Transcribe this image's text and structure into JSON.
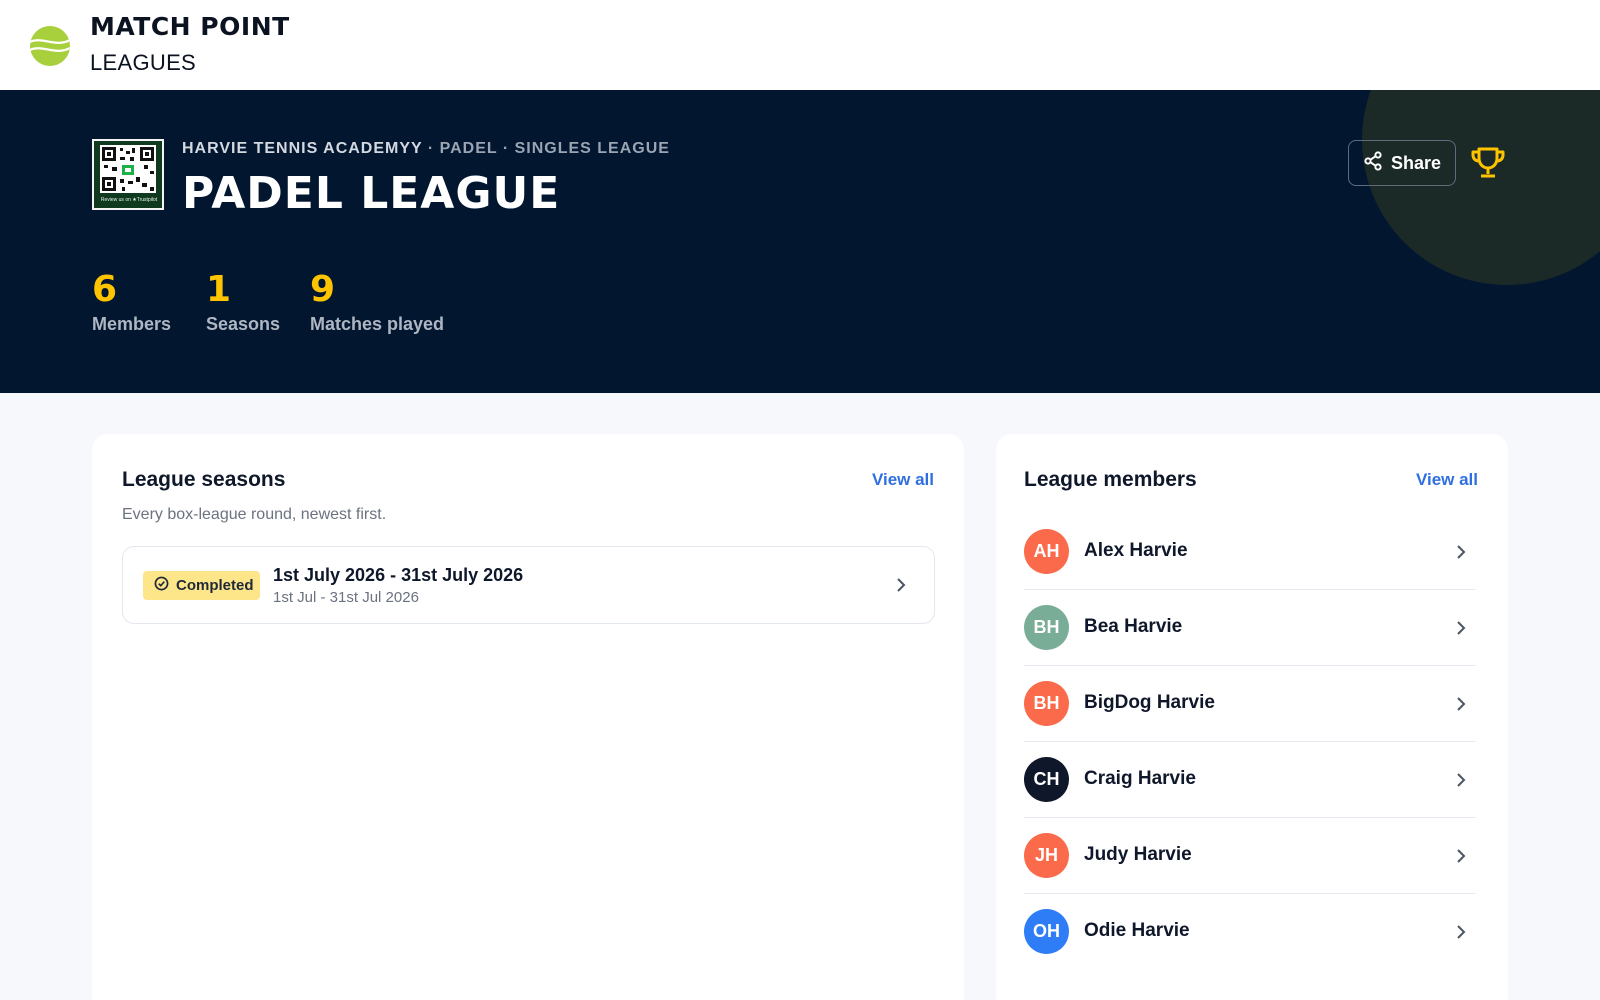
{
  "brand": {
    "title": "MATCH POINT",
    "subtitle": "LEAGUES"
  },
  "hero": {
    "club": "HARVIE TENNIS ACADEMYY",
    "meta": " · PADEL · SINGLES LEAGUE",
    "title": "PADEL LEAGUE",
    "qr_caption": "Review us on ★Trustpilot",
    "stats": [
      {
        "value": "6",
        "label": "Members"
      },
      {
        "value": "1",
        "label": "Seasons"
      },
      {
        "value": "9",
        "label": "Matches played"
      }
    ],
    "share_label": "Share",
    "accent_color": "#ffc400"
  },
  "seasons": {
    "title": "League seasons",
    "view_all": "View all",
    "subtitle": "Every box-league round, newest first.",
    "items": [
      {
        "status": "Completed",
        "name": "1st July 2026 - 31st July 2026",
        "dates": "1st Jul - 31st Jul 2026"
      }
    ]
  },
  "members": {
    "title": "League members",
    "view_all": "View all",
    "items": [
      {
        "initials": "AH",
        "name": "Alex Harvie",
        "color": "#fb6a4a"
      },
      {
        "initials": "BH",
        "name": "Bea Harvie",
        "color": "#79ad97"
      },
      {
        "initials": "BH",
        "name": "BigDog Harvie",
        "color": "#fb6a4a"
      },
      {
        "initials": "CH",
        "name": "Craig Harvie",
        "color": "#0f172a"
      },
      {
        "initials": "JH",
        "name": "Judy Harvie",
        "color": "#fb6a4a"
      },
      {
        "initials": "OH",
        "name": "Odie Harvie",
        "color": "#2f7df6"
      }
    ]
  },
  "icons": [
    "tennis-ball-logo-icon",
    "qr-code-icon",
    "share-icon",
    "trophy-icon",
    "check-circle-icon",
    "chevron-right-icon"
  ]
}
